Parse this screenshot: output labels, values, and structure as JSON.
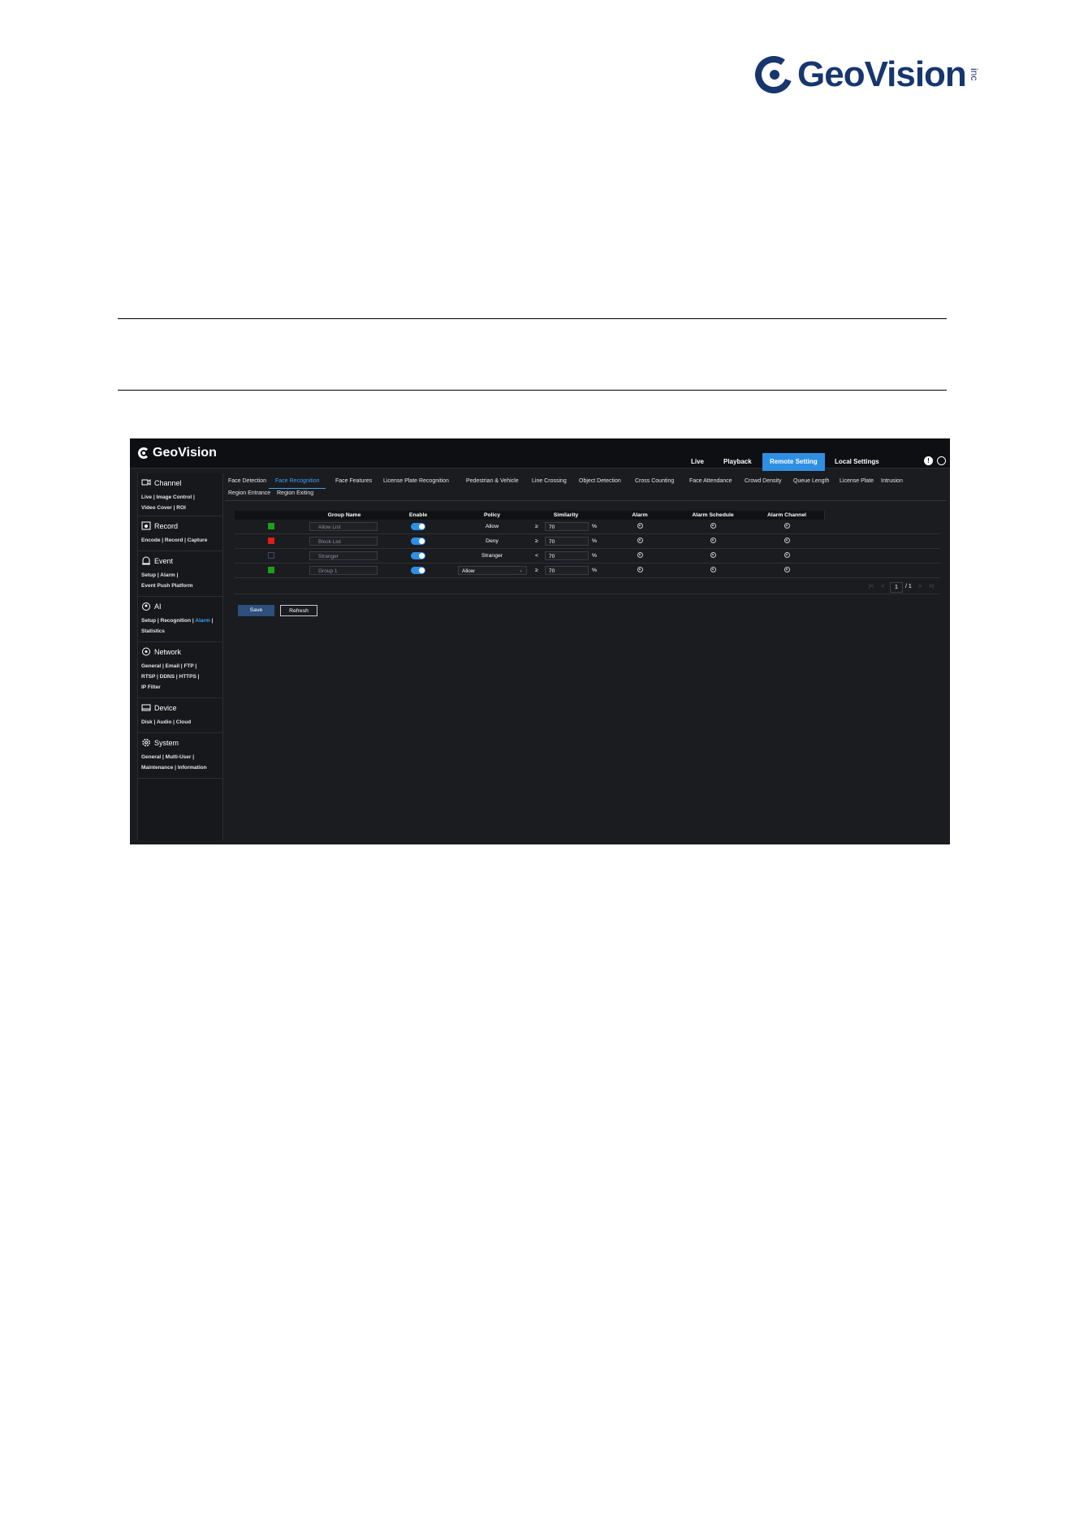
{
  "doc_logo": {
    "brand": "GeoVision",
    "suffix": "inc"
  },
  "ui": {
    "logo": "GeoVision",
    "top_nav": [
      {
        "label": "Live"
      },
      {
        "label": "Playback"
      },
      {
        "label": "Remote Setting",
        "active": true
      },
      {
        "label": "Local Settings"
      }
    ],
    "sidebar": [
      {
        "title": "Channel",
        "icon": "camera-icon",
        "links": [
          "Live",
          "Image Control",
          "Video Cover",
          "ROI"
        ]
      },
      {
        "title": "Record",
        "icon": "record-icon",
        "links": [
          "Encode",
          "Record",
          "Capture"
        ]
      },
      {
        "title": "Event",
        "icon": "alarm-bell-icon",
        "links": [
          "Setup",
          "Alarm",
          "Event Push Platform"
        ]
      },
      {
        "title": "AI",
        "icon": "ai-head-icon",
        "links": [
          "Setup",
          "Recognition",
          "Alarm",
          "Statistics"
        ],
        "highlight": "Alarm"
      },
      {
        "title": "Network",
        "icon": "network-icon",
        "links": [
          "General",
          "Email",
          "FTP",
          "RTSP",
          "DDNS",
          "HTTPS",
          "IP Filter"
        ]
      },
      {
        "title": "Device",
        "icon": "device-icon",
        "links": [
          "Disk",
          "Audio",
          "Cloud"
        ]
      },
      {
        "title": "System",
        "icon": "system-gear-icon",
        "links": [
          "General",
          "Multi-User",
          "Maintenance",
          "Information"
        ]
      }
    ],
    "tabs_row1": [
      "Face Detection",
      "Face Recognition",
      "Face Features",
      "License Plate Recognition",
      "Pedestrian & Vehicle",
      "Line Crossing",
      "Object Detection",
      "Cross Counting",
      "Face Attendance",
      "Crowd Density",
      "Queue Length",
      "License Plate",
      "Intrusion"
    ],
    "tabs_row2": [
      "Region Entrance",
      "Region Exiting"
    ],
    "active_tab": "Face Recognition",
    "table": {
      "headers": [
        "",
        "Group Name",
        "Enable",
        "Policy",
        "Similarity",
        "Alarm",
        "Alarm Schedule",
        "Alarm Channel"
      ],
      "rows": [
        {
          "color": "#1aa01a",
          "name": "Allow List",
          "enabled": true,
          "policy": "Allow",
          "policy_select": false,
          "op": "≥",
          "similarity": "70",
          "unit": "%"
        },
        {
          "color": "#e01c1c",
          "name": "Block List",
          "enabled": true,
          "policy": "Deny",
          "policy_select": false,
          "op": "≥",
          "similarity": "70",
          "unit": "%"
        },
        {
          "color": "#1b1c20",
          "name": "Stranger",
          "enabled": true,
          "policy": "Stranger",
          "policy_select": false,
          "op": "<",
          "similarity": "70",
          "unit": "%"
        },
        {
          "color": "#1aa01a",
          "name": "Group 1",
          "enabled": true,
          "policy": "Allow",
          "policy_select": true,
          "op": "≥",
          "similarity": "70",
          "unit": "%"
        }
      ]
    },
    "pager": {
      "current": "1",
      "total": "/ 1"
    },
    "buttons": {
      "save": "Save",
      "refresh": "Refresh"
    }
  }
}
